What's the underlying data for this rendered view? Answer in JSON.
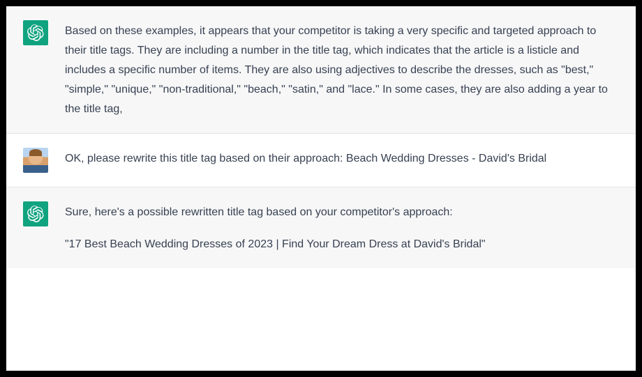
{
  "messages": {
    "m1": {
      "role": "assistant",
      "text": "Based on these examples, it appears that your competitor is taking a very specific and targeted approach to their title tags. They are including a number in the title tag, which indicates that the article is a listicle and includes a specific number of items. They are also using adjectives to describe the dresses, such as \"best,\" \"simple,\" \"unique,\" \"non-traditional,\" \"beach,\" \"satin,\" and \"lace.\" In some cases, they are also adding a year to the title tag,"
    },
    "m2": {
      "role": "user",
      "text": "OK, please rewrite this title tag based on their approach: Beach Wedding Dresses - David's Bridal"
    },
    "m3": {
      "role": "assistant",
      "p1": "Sure, here's a possible rewritten title tag based on your competitor's approach:",
      "p2": "\"17 Best Beach Wedding Dresses of 2023 | Find Your Dream Dress at David's Bridal\""
    }
  },
  "icons": {
    "assistant": "chatgpt-logo",
    "user": "user-avatar"
  }
}
